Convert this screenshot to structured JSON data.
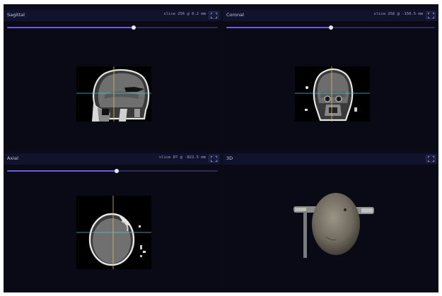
{
  "panels": {
    "sagittal": {
      "title": "Sagittal",
      "info": "slice 256  @ 0.2 mm",
      "slider": 0.6,
      "icon": "fullscreen-icon"
    },
    "coronal": {
      "title": "Coronal",
      "info": "slice 256  @ -150.5 mm",
      "slider": 0.5,
      "icon": "fullscreen-icon"
    },
    "axial": {
      "title": "Axial",
      "info": "slice 87  @ -822.5 mm",
      "slider": 0.52,
      "icon": "fullscreen-icon"
    },
    "view3d": {
      "title": "3D",
      "icon": "fullscreen-icon"
    }
  },
  "colors": {
    "background": "#0b0b1d",
    "panel_header": "#11132d",
    "slider_fill": "#6b5ee0",
    "crosshair_vertical": "#d6c25a",
    "crosshair_horizontal": "#4fc7d9"
  }
}
